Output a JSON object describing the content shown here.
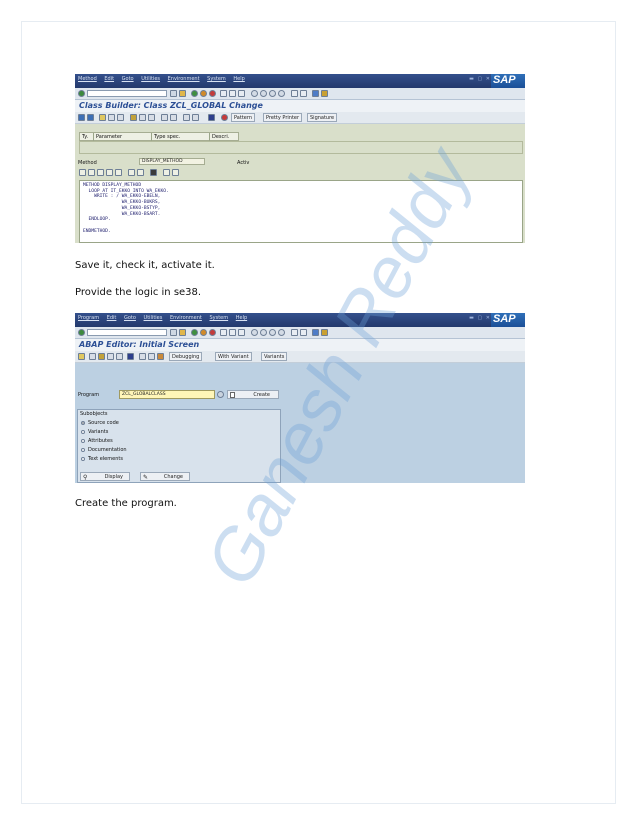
{
  "shot1": {
    "menu": [
      "Method",
      "Edit",
      "Goto",
      "Utilities",
      "Environment",
      "System",
      "Help"
    ],
    "title": "Class Builder: Class ZCL_GLOBAL Change",
    "appbar_buttons": [
      "Pattern",
      "Pretty Printer",
      "Signature"
    ],
    "param_headers": [
      "Ty.",
      "Parameter",
      "Type spec.",
      "Descri."
    ],
    "method_label": "Method",
    "method_value": "DISPLAY_METHOD",
    "status_value": "Activ",
    "code_lines": [
      "METHOD DISPLAY_METHOD",
      "  LOOP AT IT_EKKO INTO WA_EKKO.",
      "    WRITE : / WA_EKKO-EBELN,",
      "              WA_EKKO-BUKRS,",
      "              WA_EKKO-BSTYP,",
      "              WA_EKKO-BSART.",
      "  ENDLOOP.",
      "",
      "ENDMETHOD."
    ]
  },
  "para1": "Save it, check it, activate it.",
  "para2": "Provide the logic in se38.",
  "shot2": {
    "menu": [
      "Program",
      "Edit",
      "Goto",
      "Utilities",
      "Environment",
      "System",
      "Help"
    ],
    "title": "ABAP Editor: Initial Screen",
    "appbar_buttons": [
      "Debugging",
      "With Variant",
      "Variants"
    ],
    "program_label": "Program",
    "program_value": "ZCL_GLOBALCLASS",
    "create_label": "Create",
    "subobjects_label": "Subobjects",
    "subobjects": [
      "Source code",
      "Variants",
      "Attributes",
      "Documentation",
      "Text elements"
    ],
    "display_label": "Display",
    "change_label": "Change"
  },
  "para3": "Create the program.",
  "sap_logo": "SAP",
  "watermark": "Ganesh Reddy"
}
